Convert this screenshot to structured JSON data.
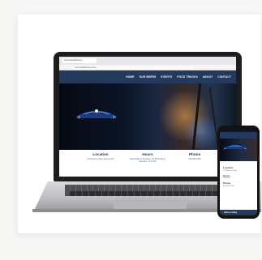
{
  "browser": {
    "tab_title": "Cornucopia Brewery",
    "url": "cornucopiabrewery.com"
  },
  "site": {
    "nav": [
      "HOME",
      "OUR BEERS",
      "EVENTS",
      "FOOD TRUCKS",
      "ABOUT",
      "CONTACT"
    ],
    "logo_text": "CORNUCOPIA BREWERY",
    "info": [
      {
        "title": "Location",
        "detail": "123 Brewery Way, Everett, WA"
      },
      {
        "title": "Hours",
        "detail": "Wednesday & Thursday: 3-9 PM\nFriday & Saturday: 12-10 PM"
      },
      {
        "title": "Phone",
        "detail": "425-555-0199"
      }
    ]
  },
  "phone": {
    "sections": [
      {
        "title": "Location",
        "detail": "123 Brewery Way"
      },
      {
        "title": "Hours",
        "detail": "Wed–Sat"
      },
      {
        "title": "Phone",
        "detail": "425-555-0199"
      }
    ],
    "footer": "Call us today"
  },
  "colors": {
    "nav_bg": "#243a5c",
    "accent": "#4a6a9a"
  }
}
